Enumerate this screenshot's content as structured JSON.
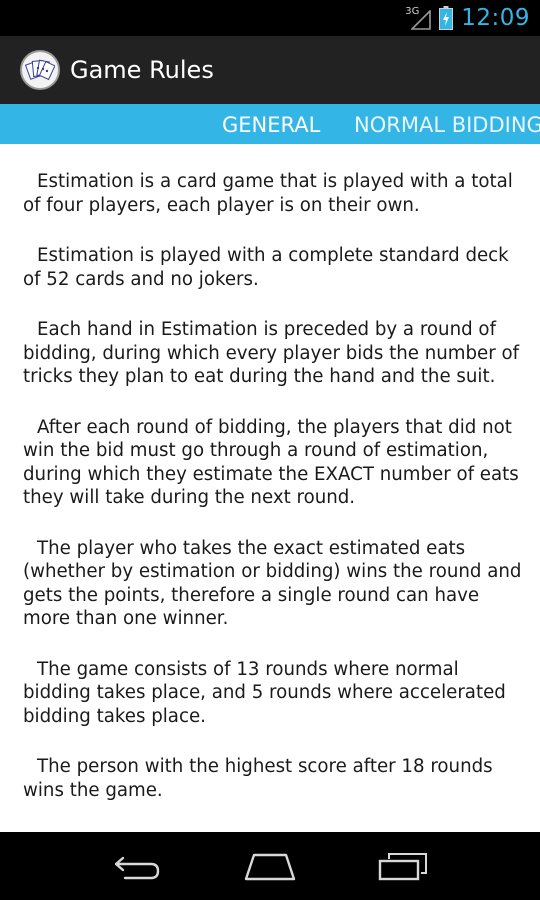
{
  "status_bar": {
    "network": "3G",
    "time": "12:09",
    "icons": [
      "signal-icon",
      "battery-charging-icon"
    ],
    "accent_color": "#33b5e5"
  },
  "action_bar": {
    "title": "Game Rules",
    "icon": "playing-cards-icon"
  },
  "tabs": [
    {
      "label": "GENERAL",
      "active": true
    },
    {
      "label": "NORMAL BIDDING",
      "active": false
    }
  ],
  "rules": [
    "Estimation is a card game that is played with a total of four players, each player is on their own.",
    "Estimation is played with a complete standard deck of 52 cards and no jokers.",
    "Each hand in Estimation is preceded by a round of bidding, during which every player bids the number of tricks they plan to eat during the hand and the suit.",
    "After each round of bidding, the players that did not win the bid must go through a round of estimation, during which they estimate the EXACT number of eats they will take during the next round.",
    "The player who takes the exact estimated eats (whether by estimation or bidding) wins the round and gets the points, therefore a single round can have more than one winner.",
    "The game consists of 13 rounds where normal bidding takes place, and 5 rounds where accelerated bidding takes place.",
    "The person with the highest score after 18 rounds wins the game."
  ],
  "nav_bar": {
    "icons": [
      "back-icon",
      "home-icon",
      "recent-apps-icon"
    ]
  }
}
